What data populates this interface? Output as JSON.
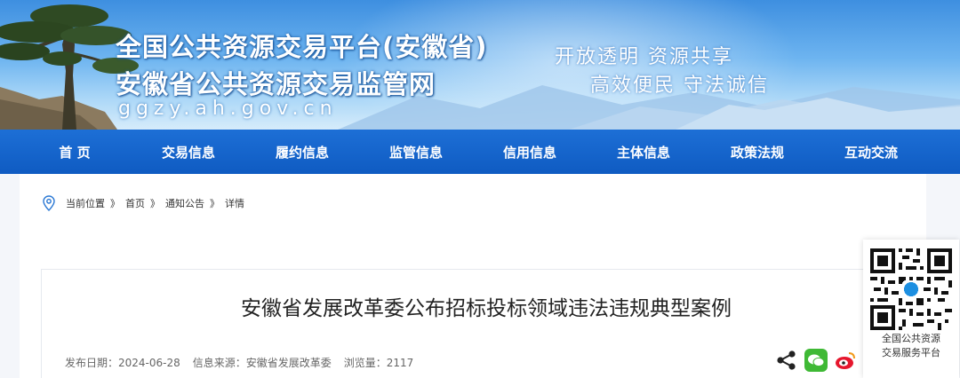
{
  "header": {
    "title_line1": "全国公共资源交易平台(安徽省)",
    "title_line2": "安徽省公共资源交易监管网",
    "domain": "ggzy.ah.gov.cn",
    "slogan_line1": "开放透明   资源共享",
    "slogan_line2": "高效便民   守法诚信"
  },
  "nav": {
    "items": [
      {
        "label": "首  页"
      },
      {
        "label": "交易信息"
      },
      {
        "label": "履约信息"
      },
      {
        "label": "监管信息"
      },
      {
        "label": "信用信息"
      },
      {
        "label": "主体信息"
      },
      {
        "label": "政策法规"
      },
      {
        "label": "互动交流"
      }
    ]
  },
  "breadcrumb": {
    "prefix": "当前位置",
    "items": [
      "首页",
      "通知公告",
      "详情"
    ],
    "separator": "》"
  },
  "article": {
    "title": "安徽省发展改革委公布招标投标领域违法违规典型案例",
    "publish_date": "发布日期：2024-06-28",
    "source": "信息来源：安徽省发展改革委",
    "views": "浏览量：2117"
  },
  "share": {
    "icons": [
      "share-icon",
      "wechat-icon",
      "weibo-icon",
      "qzone-icon"
    ]
  },
  "qr": {
    "label_line1": "全国公共资源",
    "label_line2": "交易服务平台"
  },
  "colors": {
    "nav_bg": "#1565c9",
    "banner_sky": "#5aa7ec",
    "wechat": "#3fb935",
    "weibo": "#e6162d",
    "qzone": "#f2b400",
    "qr_badge": "#1d8fe1"
  }
}
